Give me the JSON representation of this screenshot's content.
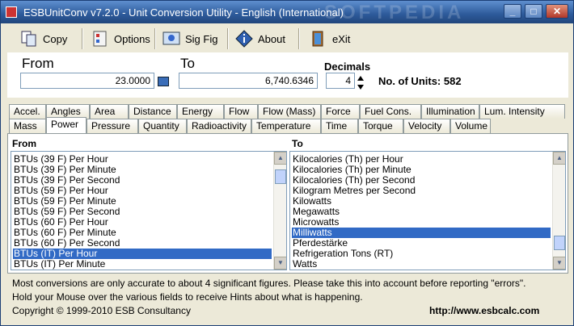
{
  "window": {
    "title": "ESBUnitConv v7.2.0 - Unit Conversion Utility - English (International)",
    "watermark": "SOFTPEDIA",
    "min_glyph": "_",
    "max_glyph": "□",
    "close_glyph": "✕"
  },
  "toolbar": {
    "copy_label": "Copy",
    "options_label": "Options",
    "sigfig_label": "Sig Fig",
    "about_label": "About",
    "exit_label": "eXit",
    "icons": [
      "copy-icon",
      "options-icon",
      "sig-fig-icon",
      "about-icon",
      "exit-icon"
    ]
  },
  "conversion": {
    "from_label": "From",
    "to_label": "To",
    "from_value": "23.0000",
    "to_value": "6,740.6346",
    "decimals_label": "Decimals",
    "decimals_value": "4",
    "units_count": "No. of Units: 582"
  },
  "tabs_row1": [
    "Accel.",
    "Angles",
    "Area",
    "Distance",
    "Energy",
    "Flow",
    "Flow (Mass)",
    "Force",
    "Fuel Cons.",
    "Illumination",
    "Lum. Intensity"
  ],
  "tabs_row2": [
    "Mass",
    "Power",
    "Pressure",
    "Quantity",
    "Radioactivity",
    "Temperature",
    "Time",
    "Torque",
    "Velocity",
    "Volume"
  ],
  "active_tab": "Power",
  "from_list": {
    "label": "From",
    "items": [
      "BTUs (39 F) Per Hour",
      "BTUs (39 F) Per Minute",
      "BTUs (39 F) Per Second",
      "BTUs (59 F) Per Hour",
      "BTUs (59 F) Per Minute",
      "BTUs (59 F) Per Second",
      "BTUs (60 F) Per Hour",
      "BTUs (60 F) Per Minute",
      "BTUs (60 F) Per Second",
      "BTUs (IT) Per Hour",
      "BTUs (IT) Per Minute"
    ],
    "selected": "BTUs (IT) Per Hour"
  },
  "to_list": {
    "label": "To",
    "items": [
      "Kilocalories (Th) per Hour",
      "Kilocalories (Th) per Minute",
      "Kilocalories (Th) per Second",
      "Kilogram Metres per Second",
      "Kilowatts",
      "Megawatts",
      "Microwatts",
      "Milliwatts",
      "Pferdestärke",
      "Refrigeration Tons (RT)",
      "Watts"
    ],
    "selected": "Milliwatts"
  },
  "hints": {
    "line1": "Most conversions are only accurate to about 4 significant figures. Please take this into account before reporting \"errors\".",
    "line2": "Hold your Mouse over the various fields to receive Hints about what is happening.",
    "copyright": "Copyright © 1999-2010 ESB Consultancy",
    "url": "http://www.esbcalc.com"
  },
  "colors": {
    "selection": "#316ac5",
    "titlebar": "#2d5a9a",
    "face": "#ece9d8"
  }
}
